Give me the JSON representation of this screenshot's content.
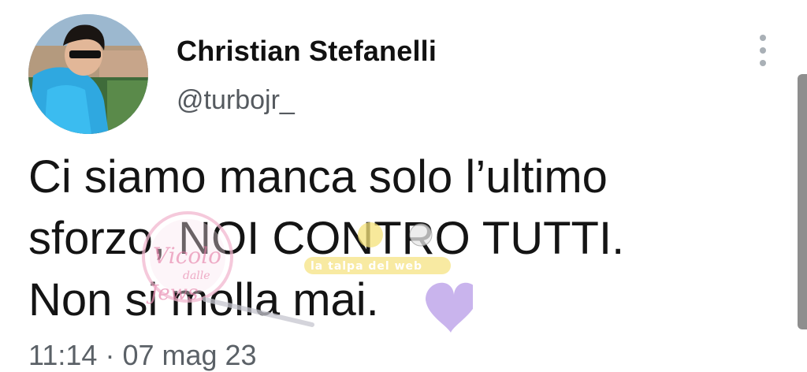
{
  "user": {
    "display_name": "Christian Stefanelli",
    "handle": "@turbojr_"
  },
  "tweet": {
    "lines": [
      "Ci siamo manca solo l’ultimo",
      "sforzo, NOI CONTRO TUTTI.",
      "Non si molla mai."
    ]
  },
  "meta": {
    "time": "11:14",
    "separator": "·",
    "date": "07 mag 23"
  },
  "watermark": {
    "script_text": "Vicolo dalle Jews",
    "banner_text": "la talpa del web"
  },
  "icons": {
    "more": "more-vertical-icon"
  },
  "colors": {
    "text": "#141414",
    "secondary": "#5b6167",
    "heart": "#b79be8"
  }
}
